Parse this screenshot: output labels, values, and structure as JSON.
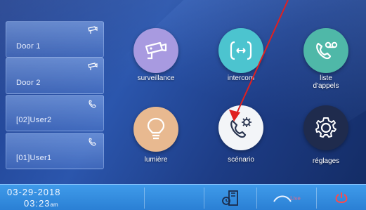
{
  "sidebar": {
    "items": [
      {
        "label": "Door 1",
        "icon": "camera-icon"
      },
      {
        "label": "Door 2",
        "icon": "camera-icon"
      },
      {
        "label": "[02]User2",
        "icon": "phone-icon"
      },
      {
        "label": "[01]User1",
        "icon": "phone-icon"
      }
    ]
  },
  "tiles": [
    {
      "label": "surveillance",
      "icon": "surveillance-camera-icon",
      "color": "#a89ae0"
    },
    {
      "label": "intercom",
      "icon": "intercom-icon",
      "color": "#4cc4cf"
    },
    {
      "label": "liste\nd'appels",
      "icon": "voicemail-phone-icon",
      "color": "#4fb8a8"
    },
    {
      "label": "lumière",
      "icon": "light-bulb-icon",
      "color": "#e8b990"
    },
    {
      "label": "scénario",
      "icon": "scenario-phone-gear-icon",
      "color": "#f3f5f8"
    },
    {
      "label": "réglages",
      "icon": "gear-icon",
      "color": "#1f2b4d"
    }
  ],
  "status_bar": {
    "date": "03-29-2018",
    "time": "03:23",
    "time_suffix": "am",
    "live_label": "Live",
    "icons": [
      "door-book-icon",
      "live-signal-icon",
      "power-icon"
    ]
  },
  "colors": {
    "background": "#2b56ad",
    "bottom_bar": "#3f9bea",
    "annotation_arrow": "#e02020",
    "power": "#ff4a4a"
  }
}
